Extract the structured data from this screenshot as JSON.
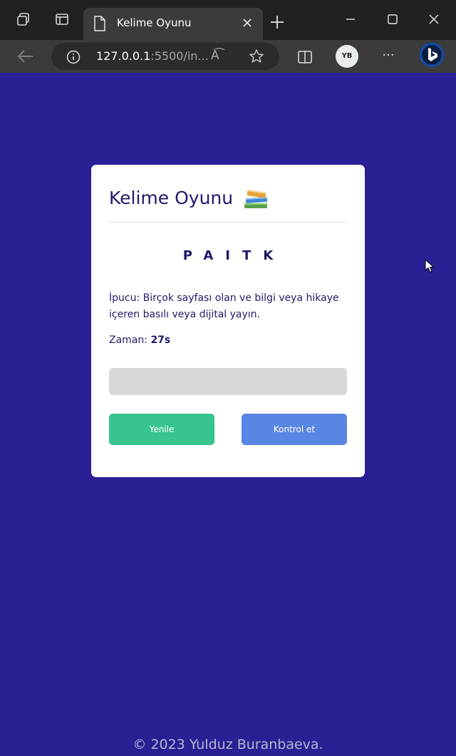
{
  "browser": {
    "tab_title": "Kelime Oyunu",
    "url_host": "127.0.0.1",
    "url_rest": ":5500/in...",
    "read_aloud_label": "A͡",
    "profile_initials": "YB",
    "more_label": "···"
  },
  "game": {
    "title": "Kelime Oyunu",
    "scrambled_word": "PAITK",
    "hint": "İpucu: Birçok sayfası olan ve bilgi veya hikaye içeren basılı veya dijital yayın.",
    "timer_label": "Zaman: ",
    "timer_value": "27s",
    "answer_value": "",
    "refresh_label": "Yenile",
    "check_label": "Kontrol et"
  },
  "footer": {
    "text": "© 2023 Yulduz Buranbaeva."
  },
  "colors": {
    "page_background": "#2a1f94",
    "card_background": "#ffffff",
    "title_color": "#1f1a6b",
    "refresh_button": "#37c48e",
    "check_button": "#5a86e3",
    "answer_field": "#d9d6d6"
  }
}
